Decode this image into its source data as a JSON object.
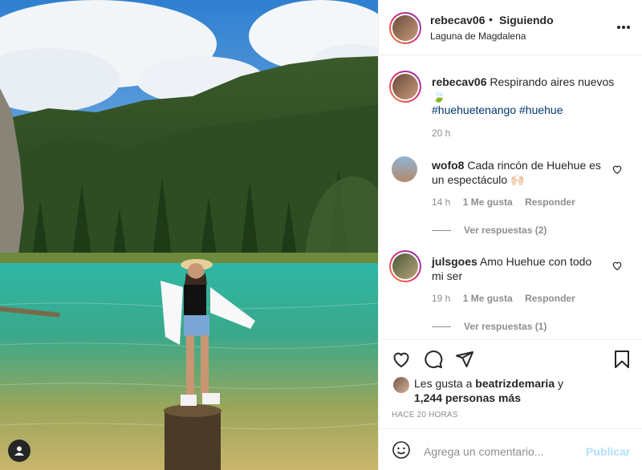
{
  "post": {
    "username": "rebecav06",
    "follow_dot": "•",
    "follow_status": "Siguiendo",
    "location": "Laguna de Magdalena",
    "more_icon": "more-horizontal-icon"
  },
  "caption": {
    "username": "rebecav06",
    "text": "Respirando aires nuevos",
    "emoji": "🍃",
    "hashtags": "#huehuetenango #huehue",
    "time": "20 h"
  },
  "comments": [
    {
      "username": "wofo8",
      "text": "Cada rincón de Huehue es un espectáculo 🙌🏻",
      "time": "14 h",
      "likes": "1 Me gusta",
      "reply": "Responder",
      "view_replies": "Ver respuestas (2)"
    },
    {
      "username": "julsgoes",
      "text": "Amo Huehue con todo mi ser",
      "time": "19 h",
      "likes": "1 Me gusta",
      "reply": "Responder",
      "view_replies": "Ver respuestas (1)"
    }
  ],
  "likes": {
    "prefix": "Les gusta a",
    "user": "beatrizdemaria",
    "conj": "y",
    "count": "1,244 personas más"
  },
  "timestamp": "HACE 20 HORAS",
  "add_comment": {
    "placeholder": "Agrega un comentario...",
    "publish": "Publicar"
  },
  "colors": {
    "link": "#00376b",
    "muted": "#8e8e8e",
    "publish_disabled": "#b2dffc"
  }
}
